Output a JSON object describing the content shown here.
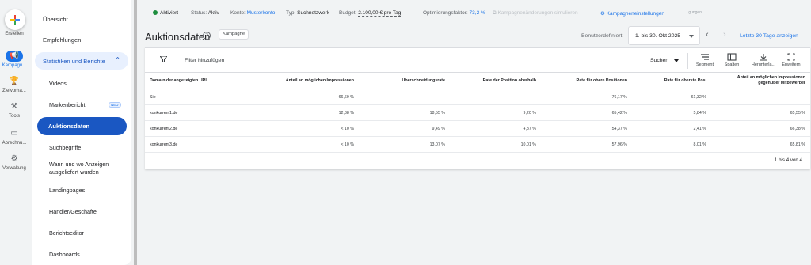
{
  "rail": {
    "items": [
      {
        "label": "Erstellen",
        "icon": "plus-icon"
      },
      {
        "label": "Kampagn...",
        "icon": "megaphone-icon"
      },
      {
        "label": "Zielvorha...",
        "icon": "trophy-icon"
      },
      {
        "label": "Tools",
        "icon": "tools-icon"
      },
      {
        "label": "Abrechnu...",
        "icon": "credit-card-icon"
      },
      {
        "label": "Verwaltung",
        "icon": "gear-icon"
      }
    ]
  },
  "sidebar": {
    "items": [
      "Übersicht",
      "Empfehlungen"
    ],
    "group_label": "Statistiken und Berichte",
    "sub_items": [
      "Videos",
      "Markenbericht",
      "Auktionsdaten",
      "Suchbegriffe",
      "Wann und wo Anzeigen ausgeliefert wurden",
      "Landingpages",
      "Händler/Geschäfte",
      "Berichtseditor",
      "Dashboards"
    ],
    "badge": "NEU"
  },
  "status": {
    "state": "Aktiviert",
    "status_label": "Status:",
    "status_value": "Aktiv",
    "account_label": "Konto:",
    "account_value": "Musterkonto",
    "type_label": "Typ:",
    "type_value": "Suchnetzwerk",
    "budget_label": "Budget:",
    "budget_value": "2.100,00 € pro Tag",
    "opt_label": "Optimierungsfaktor:",
    "opt_value": "73,2 %",
    "simulate": "Kampagnenänderungen simulieren",
    "settings": "Kampagneneinstellungen",
    "top_fragment": "gungen"
  },
  "header": {
    "title": "Auktionsdaten",
    "chip": "Kampagne",
    "range_label": "Benutzerdefiniert",
    "date_range": "1. bis 30. Okt 2025",
    "quick_range": "Letzte 30 Tage anzeigen"
  },
  "toolbar": {
    "filter": "Filter hinzufügen",
    "search": "Suchen",
    "segment": "Segment",
    "columns": "Spalten",
    "download": "Herunterla...",
    "expand": "Erweitern"
  },
  "table": {
    "columns": [
      "Domain der angezeigten URL",
      "↓ Anteil an möglichen Impressionen",
      "Überschneidungsrate",
      "Rate der Position oberhalb",
      "Rate für obere Positionen",
      "Rate für oberste Pos.",
      "Anteil an möglichen Impressionen gegenüber Mitbewerber"
    ],
    "rows": [
      [
        "Sie",
        "66,69 %",
        "—",
        "—",
        "76,17 %",
        "61,32 %",
        "—"
      ],
      [
        "konkurrent1.de",
        "12,88 %",
        "18,55 %",
        "9,20 %",
        "65,42 %",
        "5,84 %",
        "65,55 %"
      ],
      [
        "konkurrent2.de",
        "< 10 %",
        "9,49 %",
        "4,87 %",
        "54,37 %",
        "2,41 %",
        "66,38 %"
      ],
      [
        "konkurrent3.de",
        "< 10 %",
        "13,07 %",
        "10,01 %",
        "57,96 %",
        "8,01 %",
        "65,81 %"
      ]
    ],
    "pagination": "1 bis 4 von 4"
  }
}
